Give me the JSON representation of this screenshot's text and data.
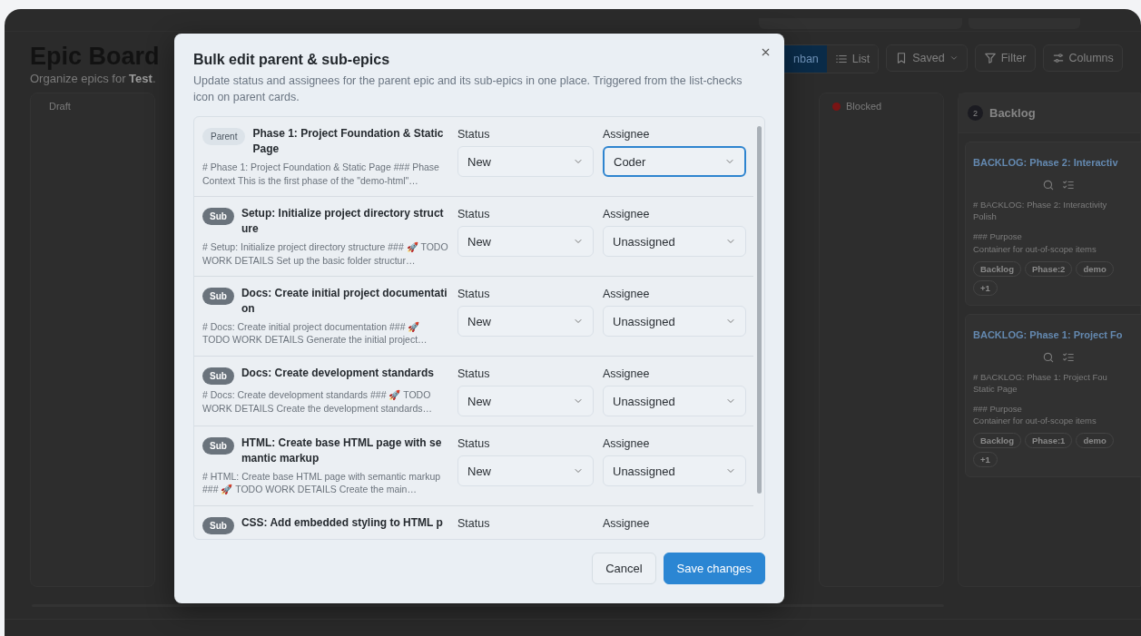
{
  "app": {
    "title": "Epic Board",
    "subtitle": "Organize epics for **Test**.",
    "view_tabs": [
      {
        "label": "nban",
        "selected": true
      },
      {
        "label": "List",
        "selected": false
      }
    ],
    "toolbar": [
      {
        "label": "Saved",
        "kind": "saved"
      },
      {
        "label": "Filter",
        "kind": "filter"
      },
      {
        "label": "Columns",
        "kind": "columns"
      }
    ],
    "columns": [
      {
        "title": "Draft"
      },
      {
        "title": "Blocked",
        "color": "#7a1414"
      },
      {
        "title": "Backlog",
        "count": "2",
        "cards": [
          {
            "title": "BACKLOG: Phase 2: Interactiv",
            "description": [
              "# BACKLOG: Phase 2: Interactivity\nPolish",
              "### Purpose\nContainer for out-of-scope items"
            ],
            "tags": [
              "Backlog",
              "Phase:2",
              "demo",
              "+1"
            ]
          },
          {
            "title": "BACKLOG: Phase 1: Project Fo",
            "description": [
              "# BACKLOG: Phase 1: Project Fou\nStatic Page",
              "### Purpose\nContainer for out-of-scope items"
            ],
            "tags": [
              "Backlog",
              "Phase:1",
              "demo",
              "+1"
            ]
          }
        ]
      }
    ]
  },
  "dialog": {
    "title": "Bulk edit parent & sub-epics",
    "description": "Update status and assignees for the parent epic and its sub-epics in one place. Triggered from the list-checks icon on parent cards.",
    "rows": [
      {
        "kind": "parent",
        "badge": "Parent",
        "title": "Phase 1: Project Foundation & Static Page",
        "description": "# Phase 1: Project Foundation & Static Page ### Phase Context This is the first phase of the \"demo-html\"…",
        "status_label": "Status",
        "status": "New",
        "assignee_label": "Assignee",
        "assignee": "Coder",
        "focused": true
      },
      {
        "kind": "sub",
        "badge": "Sub",
        "title": "Setup: Initialize project directory structure",
        "description": "# Setup: Initialize project directory structure ### 🚀 TODO WORK DETAILS Set up the basic folder structur…",
        "status_label": "Status",
        "status": "New",
        "assignee_label": "Assignee",
        "assignee": "Unassigned",
        "focused": false
      },
      {
        "kind": "sub",
        "badge": "Sub",
        "title": "Docs: Create initial project documentation",
        "description": "# Docs: Create initial project documentation ### 🚀 TODO WORK DETAILS Generate the initial project…",
        "status_label": "Status",
        "status": "New",
        "assignee_label": "Assignee",
        "assignee": "Unassigned",
        "focused": false
      },
      {
        "kind": "sub",
        "badge": "Sub",
        "title": "Docs: Create development standards",
        "description": "# Docs: Create development standards ### 🚀 TODO WORK DETAILS Create the development standards…",
        "status_label": "Status",
        "status": "New",
        "assignee_label": "Assignee",
        "assignee": "Unassigned",
        "focused": false
      },
      {
        "kind": "sub",
        "badge": "Sub",
        "title": "HTML: Create base HTML page with semantic markup",
        "description": "# HTML: Create base HTML page with semantic markup ### 🚀 TODO WORK DETAILS Create the main…",
        "status_label": "Status",
        "status": "New",
        "assignee_label": "Assignee",
        "assignee": "Unassigned",
        "focused": false
      },
      {
        "kind": "sub",
        "badge": "Sub",
        "title": "CSS: Add embedded styling to HTML p",
        "status_label": "Status",
        "assignee_label": "Assignee"
      }
    ],
    "buttons": [
      {
        "label": "Cancel",
        "kind": "secondary"
      },
      {
        "label": "Save changes",
        "kind": "primary"
      }
    ]
  }
}
